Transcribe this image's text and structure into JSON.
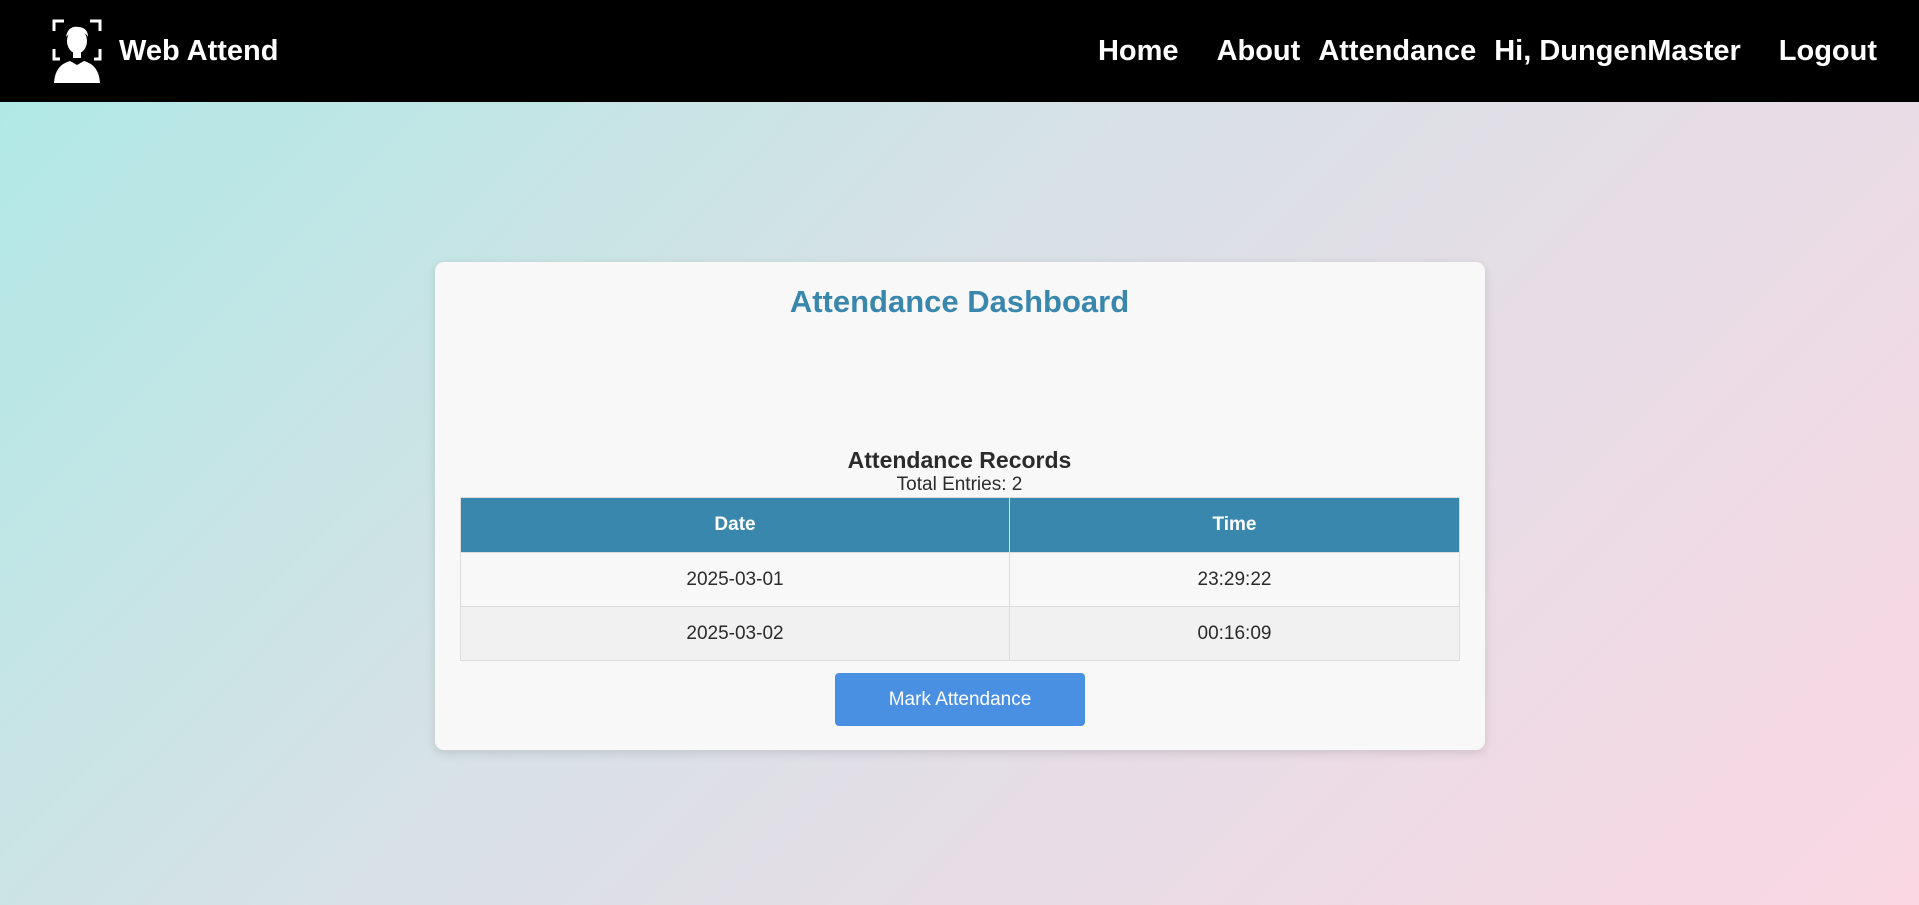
{
  "navbar": {
    "brand": "Web Attend",
    "links": {
      "home": "Home",
      "about": "About",
      "attendance": "Attendance",
      "greeting": "Hi, DungenMaster",
      "logout": "Logout"
    }
  },
  "dashboard": {
    "title": "Attendance Dashboard",
    "records_title": "Attendance Records",
    "total_entries": "Total Entries: 2",
    "columns": [
      "Date",
      "Time"
    ],
    "rows": [
      {
        "date": "2025-03-01",
        "time": "23:29:22"
      },
      {
        "date": "2025-03-02",
        "time": "00:16:09"
      }
    ],
    "mark_button": "Mark Attendance"
  },
  "colors": {
    "navbar_bg": "#000000",
    "accent": "#3a87ad",
    "button": "#4a90e2"
  },
  "icons": {
    "brand_logo": "face-scan-icon"
  }
}
